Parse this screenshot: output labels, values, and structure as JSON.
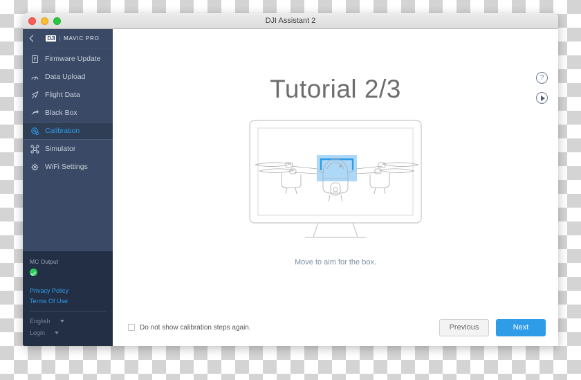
{
  "window": {
    "title": "DJI Assistant 2",
    "traffic_lights": [
      {
        "name": "close",
        "color": "#ff5f57"
      },
      {
        "name": "minimize",
        "color": "#febc2e"
      },
      {
        "name": "zoom",
        "color": "#28c840"
      }
    ]
  },
  "sidebar": {
    "back_label": "‹",
    "brand_mark": "DJI",
    "brand_separator": "|",
    "brand_model": "MAVIC PRO",
    "items": [
      {
        "label": "Firmware Update",
        "icon": "firmware-chip-icon",
        "active": false
      },
      {
        "label": "Data Upload",
        "icon": "gauge-icon",
        "active": false
      },
      {
        "label": "Flight Data",
        "icon": "paper-plane-icon",
        "active": false
      },
      {
        "label": "Black Box",
        "icon": "arrow-icon",
        "active": false
      },
      {
        "label": "Calibration",
        "icon": "calibration-gear-icon",
        "active": true
      },
      {
        "label": "Simulator",
        "icon": "drone-icon",
        "active": false
      },
      {
        "label": "WiFi Settings",
        "icon": "wifi-gear-icon",
        "active": false
      }
    ],
    "footer": {
      "mc_output_label": "MC Output",
      "mc_output_status": "ok",
      "status_color": "#2ecc5a",
      "privacy_policy": "Privacy Policy",
      "terms_of_use": "Terms Of Use",
      "language": "English",
      "account": "Login",
      "link_color": "#2f9ce8"
    }
  },
  "main": {
    "title": "Tutorial 2/3",
    "caption": "Move to aim for the box.",
    "help_icon_label": "?",
    "tools": [
      {
        "name": "help-icon",
        "label": "?"
      },
      {
        "name": "play-icon",
        "label": ""
      }
    ],
    "illustration": {
      "name": "monitor-with-drone-illustration",
      "target_box_color": "#2f9ce8",
      "target_box_fill": "#aed8f7",
      "outline_color": "#cccccc"
    },
    "footer": {
      "checkbox_label": "Do not show calibration steps again.",
      "checkbox_checked": false,
      "previous_label": "Previous",
      "next_label": "Next",
      "primary_color": "#2f9ce8"
    }
  }
}
